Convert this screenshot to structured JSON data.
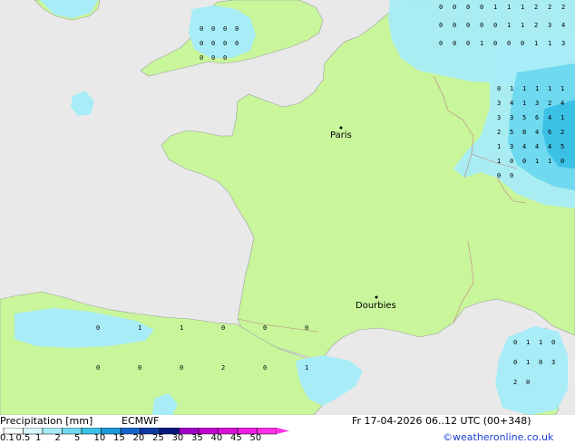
{
  "title": "Precipitation [mm]",
  "model": "ECMWF",
  "datetime": "Fr 17-04-2026 06..12 UTC (00+348)",
  "credit": "©weatheronline.co.uk",
  "cities": [
    {
      "name": "Paris"
    },
    {
      "name": "Dourbies"
    }
  ],
  "legend": {
    "labels": [
      "0.1",
      "0.5",
      "1",
      "2",
      "5",
      "10",
      "15",
      "20",
      "25",
      "30",
      "35",
      "40",
      "45",
      "50"
    ],
    "colors": [
      "#f5fffe",
      "#d6f7fc",
      "#a8ecf7",
      "#6fd9ef",
      "#3cc1e6",
      "#1c9ad8",
      "#1565c8",
      "#0d3aa0",
      "#081880",
      "#a000c8",
      "#c000d0",
      "#d810d8",
      "#ec20e0",
      "#ff30e8"
    ]
  },
  "colors": {
    "sea": "#e9e9e9",
    "land": "#c9f59b",
    "light_precip": "#a8ecf7",
    "mid_precip": "#6fd9ef",
    "heavy_precip": "#3cc1e6"
  },
  "grid_values": {
    "north_sea": [
      "0",
      "0",
      "0",
      "0",
      "1",
      "1",
      "1",
      "2",
      "2",
      "2",
      "0",
      "0",
      "0",
      "0",
      "0",
      "1",
      "1",
      "2",
      "3",
      "4",
      "0",
      "0",
      "0",
      "1",
      "0",
      "0",
      "0",
      "1",
      "1",
      "3"
    ],
    "germany_alps": [
      "0",
      "1",
      "1",
      "1",
      "1",
      "1",
      "3",
      "4",
      "1",
      "3",
      "2",
      "4",
      "3",
      "3",
      "5",
      "6",
      "4",
      "1",
      "2",
      "5",
      "8",
      "4",
      "6",
      "2",
      "1",
      "3",
      "4",
      "4",
      "4",
      "5",
      "1",
      "0",
      "0",
      "1",
      "1",
      "0",
      "0",
      "0"
    ],
    "uk": [
      "0",
      "0",
      "0",
      "0",
      "0",
      "0",
      "0",
      "0",
      "0",
      "0",
      "0"
    ],
    "spain": [
      "0",
      "1",
      "1",
      "0",
      "0",
      "0",
      "0",
      "0",
      "0",
      "2",
      "0",
      "1"
    ],
    "corsica": [
      "0",
      "1",
      "1",
      "0",
      "0",
      "1",
      "0",
      "3",
      "2",
      "0"
    ]
  }
}
